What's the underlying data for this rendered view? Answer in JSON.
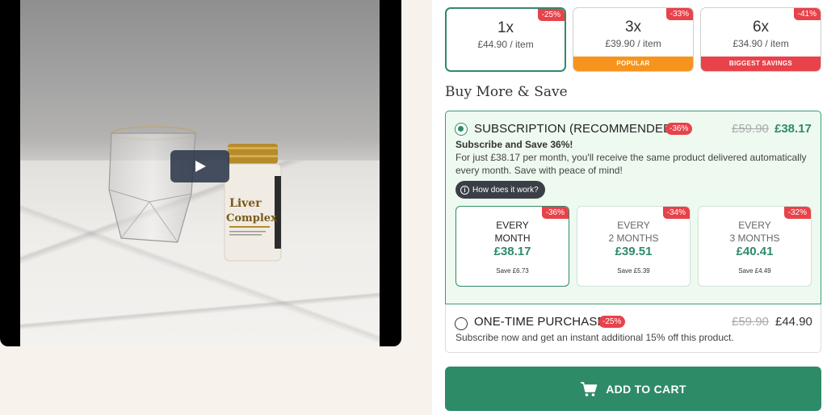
{
  "quantity_options": [
    {
      "count": "1x",
      "price": "£44.90 / item",
      "discount": "-25%",
      "ribbon": "",
      "selected": true
    },
    {
      "count": "3x",
      "price": "£39.90 / item",
      "discount": "-33%",
      "ribbon": "POPULAR",
      "ribbon_color": "#f7941d"
    },
    {
      "count": "6x",
      "price": "£34.90 / item",
      "discount": "-41%",
      "ribbon": "BIGGEST SAVINGS",
      "ribbon_color": "#e8424a"
    }
  ],
  "section_title": "Buy More & Save",
  "subscription": {
    "title": "SUBSCRIPTION (RECOMMENDED)",
    "discount": "-36%",
    "old_price": "£59.90",
    "new_price": "£38.17",
    "heading": "Subscribe and Save 36%!",
    "description": "For just £38.17 per month, you'll receive the same product delivered automatically every month. Save with peace of mind!",
    "how_label": "How does it work?",
    "frequencies": [
      {
        "line1": "EVERY",
        "line2": "MONTH",
        "price": "£38.17",
        "save": "Save £6.73",
        "discount": "-36%",
        "selected": true
      },
      {
        "line1": "EVERY",
        "line2": "2 MONTHS",
        "price": "£39.51",
        "save": "Save £5.39",
        "discount": "-34%"
      },
      {
        "line1": "EVERY",
        "line2": "3 MONTHS",
        "price": "£40.41",
        "save": "Save £4.49",
        "discount": "-32%"
      }
    ]
  },
  "one_time": {
    "title": "ONE-TIME PURCHASE",
    "discount": "-25%",
    "old_price": "£59.90",
    "price": "£44.90",
    "description": "Subscribe now and get an instant additional 15% off this product."
  },
  "cart_button": {
    "label": "ADD TO CART",
    "icon": "cart-icon"
  },
  "video": {
    "play_icon": "play-icon"
  },
  "product_label": {
    "brand": "Liver",
    "name": "Complex"
  },
  "colors": {
    "accent": "#2e8b68",
    "badge": "#e8424a",
    "popular": "#f7941d",
    "sub_bg": "#eef9f0"
  }
}
